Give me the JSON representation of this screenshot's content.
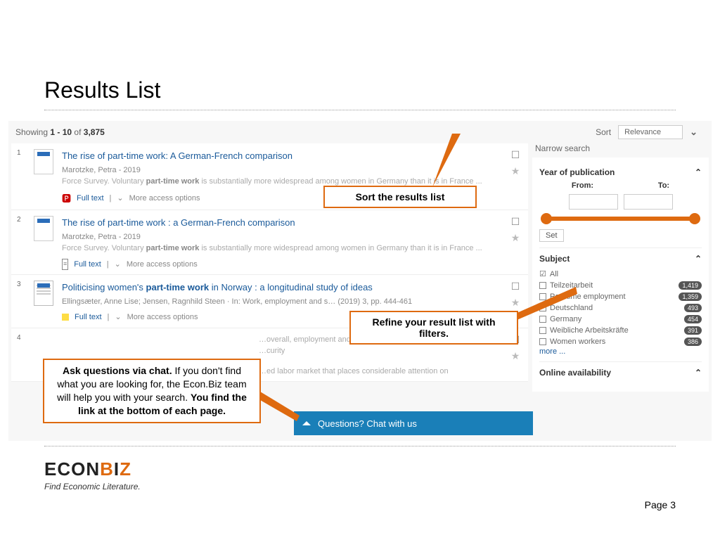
{
  "slide": {
    "title": "Results List",
    "page_label": "Page 3"
  },
  "header": {
    "showing_prefix": "Showing",
    "range": "1 - 10",
    "of_word": "of",
    "total": "3,875",
    "sort_label": "Sort",
    "sort_value": "Relevance"
  },
  "narrow": {
    "heading": "Narrow search",
    "year_section": "Year of publication",
    "from_label": "From:",
    "to_label": "To:",
    "set_btn": "Set",
    "subject_section": "Subject",
    "all_label": "All",
    "subjects": [
      {
        "label": "Teilzeitarbeit",
        "count": "1,419"
      },
      {
        "label": "Part-time employment",
        "count": "1,359"
      },
      {
        "label": "Deutschland",
        "count": "493"
      },
      {
        "label": "Germany",
        "count": "454"
      },
      {
        "label": "Weibliche Arbeitskräfte",
        "count": "391"
      },
      {
        "label": "Women workers",
        "count": "386"
      }
    ],
    "more": "more ...",
    "online_section": "Online availability"
  },
  "results": [
    {
      "num": "1",
      "type": "Book",
      "title": "The rise of part-time work: A German-French comparison",
      "meta": "Marotzke, Petra - 2019",
      "snippet_a": "Force Survey. Voluntary ",
      "snippet_b": "part-time work",
      "snippet_c": " is substantially more widespread among women in Germany than it is in France ...",
      "icon": "pdf",
      "fulltext": "Full text",
      "more": "More access options"
    },
    {
      "num": "2",
      "type": "Book",
      "title": "The rise of part-time work : a German-French comparison",
      "meta": "Marotzke, Petra - 2019",
      "snippet_a": "Force Survey. Voluntary ",
      "snippet_b": "part-time work",
      "snippet_c": " is substantially more widespread among women in Germany than it is in France ...",
      "icon": "doc",
      "fulltext": "Full text",
      "more": "More access options"
    },
    {
      "num": "3",
      "type": "Article",
      "title_a": "Politicising women's ",
      "title_b": "part-time work",
      "title_c": " in Norway : a longitudinal study of ideas",
      "meta": "Ellingsæter, Anne Lise; Jensen, Ragnhild Steen · In: Work, employment and s… (2019) 3, pp. 444-461",
      "icon": "square",
      "fulltext": "Full text",
      "more": "More access options"
    },
    {
      "num": "4",
      "snippet_a": "…overall, employment and wages were accompanied",
      "snippet_b": "…curity",
      "snippet_c": "…ed labor market that places considerable attention on"
    }
  ],
  "callouts": {
    "sort": "Sort the results list",
    "refine": "Refine your result list with filters.",
    "chat_a": "Ask questions via chat.",
    "chat_b": " If you don't find what you are looking for, the Econ.Biz team will help you with your search. ",
    "chat_c": "You find the link at the bottom of each page."
  },
  "chat": {
    "label": "Questions? Chat with us"
  },
  "logo": {
    "a": "ECON",
    "b": "B",
    "c": "I",
    "d": "Z",
    "tagline": "Find Economic Literature."
  }
}
